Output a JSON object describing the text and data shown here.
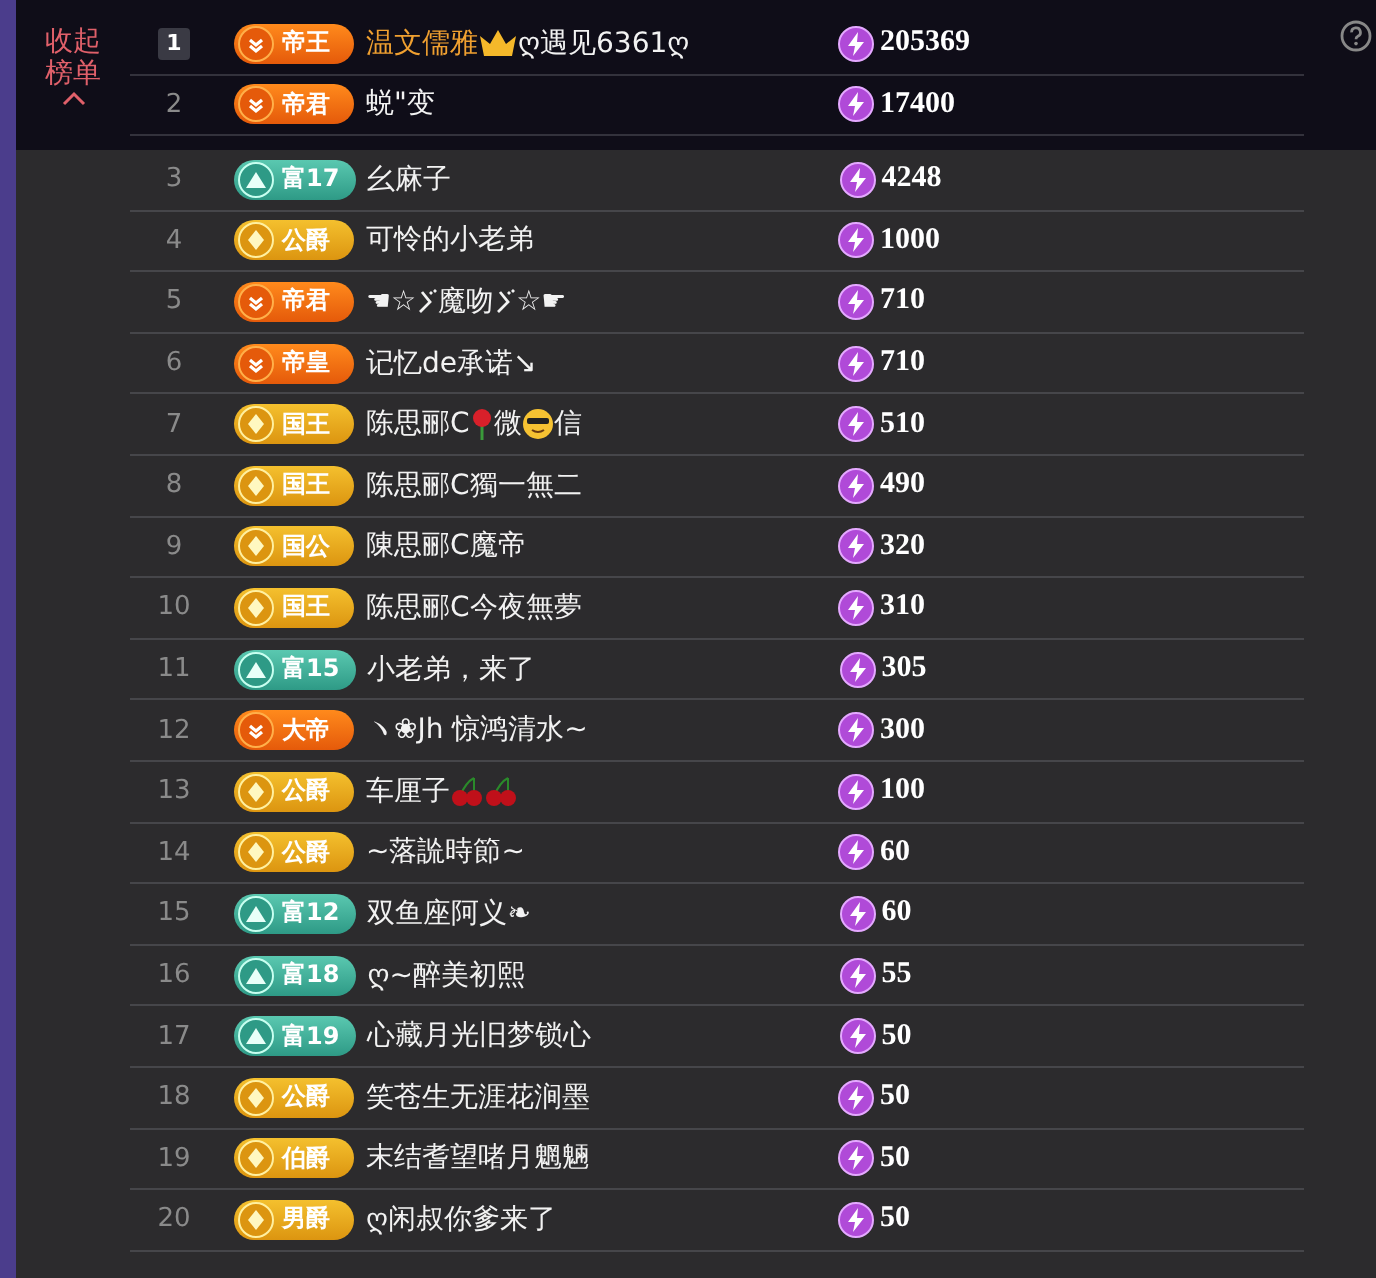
{
  "collapse_button": {
    "label": "收起榜单"
  },
  "rows": [
    {
      "rank": "1",
      "top": true,
      "badge": {
        "kind": "orange",
        "label": "帝王"
      },
      "name_parts": [
        {
          "kind": "highlight",
          "text": "温文儒雅"
        },
        {
          "kind": "crown"
        },
        {
          "kind": "text",
          "text": "ღ遇见6361ღ"
        }
      ],
      "value": "205369"
    },
    {
      "rank": "2",
      "top": false,
      "badge": {
        "kind": "orange",
        "label": "帝君"
      },
      "name": "蜕\"变",
      "value": "17400"
    },
    {
      "rank": "3",
      "top": false,
      "badge": {
        "kind": "teal",
        "label": "富17"
      },
      "name": "幺麻子",
      "value": "4248"
    },
    {
      "rank": "4",
      "top": false,
      "badge": {
        "kind": "gold",
        "label": "公爵"
      },
      "name": "可怜的小老弟",
      "value": "1000"
    },
    {
      "rank": "5",
      "top": false,
      "badge": {
        "kind": "orange",
        "label": "帝君"
      },
      "name_parts": [
        {
          "kind": "text",
          "text": "☚☆"
        },
        {
          "kind": "squiggle"
        },
        {
          "kind": "text",
          "text": "魔吻"
        },
        {
          "kind": "squiggle"
        },
        {
          "kind": "text",
          "text": "☆☛"
        }
      ],
      "value": "710"
    },
    {
      "rank": "6",
      "top": false,
      "badge": {
        "kind": "orange",
        "label": "帝皇"
      },
      "name": "记忆de承诺↘",
      "value": "710"
    },
    {
      "rank": "7",
      "top": false,
      "badge": {
        "kind": "gold",
        "label": "国王"
      },
      "name_parts": [
        {
          "kind": "text",
          "text": "陈思郦C"
        },
        {
          "kind": "flower"
        },
        {
          "kind": "text",
          "text": "微"
        },
        {
          "kind": "face"
        },
        {
          "kind": "text",
          "text": "信"
        }
      ],
      "value": "510"
    },
    {
      "rank": "8",
      "top": false,
      "badge": {
        "kind": "gold",
        "label": "国王"
      },
      "name": "陈思郦C獨一無二",
      "value": "490"
    },
    {
      "rank": "9",
      "top": false,
      "badge": {
        "kind": "gold",
        "label": "国公"
      },
      "name": "陳思郦C魔帝",
      "value": "320"
    },
    {
      "rank": "10",
      "top": false,
      "badge": {
        "kind": "gold",
        "label": "国王"
      },
      "name": "陈思郦C今夜無夢",
      "value": "310"
    },
    {
      "rank": "11",
      "top": false,
      "badge": {
        "kind": "teal",
        "label": "富15"
      },
      "name": "小老弟，来了",
      "value": "305"
    },
    {
      "rank": "12",
      "top": false,
      "badge": {
        "kind": "orange",
        "label": "大帝"
      },
      "name": "ヽ❀Jh 惊鸿清水~",
      "value": "300"
    },
    {
      "rank": "13",
      "top": false,
      "badge": {
        "kind": "gold",
        "label": "公爵"
      },
      "name_parts": [
        {
          "kind": "text",
          "text": "车厘子"
        },
        {
          "kind": "cherry"
        },
        {
          "kind": "cherry"
        }
      ],
      "value": "100"
    },
    {
      "rank": "14",
      "top": false,
      "badge": {
        "kind": "gold",
        "label": "公爵"
      },
      "name": "~落詤時節~",
      "value": "60"
    },
    {
      "rank": "15",
      "top": false,
      "badge": {
        "kind": "teal",
        "label": "富12"
      },
      "name": "双鱼座阿义❧",
      "value": "60"
    },
    {
      "rank": "16",
      "top": false,
      "badge": {
        "kind": "teal",
        "label": "富18"
      },
      "name": "ღ~醉美初熙",
      "value": "55"
    },
    {
      "rank": "17",
      "top": false,
      "badge": {
        "kind": "teal",
        "label": "富19"
      },
      "name": "心藏月光旧梦锁心",
      "value": "50"
    },
    {
      "rank": "18",
      "top": false,
      "badge": {
        "kind": "gold",
        "label": "公爵"
      },
      "name": "笑苍生无涯花涧墨",
      "value": "50"
    },
    {
      "rank": "19",
      "top": false,
      "badge": {
        "kind": "gold",
        "label": "伯爵"
      },
      "name": "末结耆望啫月魍魎",
      "value": "50"
    },
    {
      "rank": "20",
      "top": false,
      "badge": {
        "kind": "gold",
        "label": "男爵"
      },
      "name": "ღ闲叔你爹来了",
      "value": "50"
    }
  ]
}
